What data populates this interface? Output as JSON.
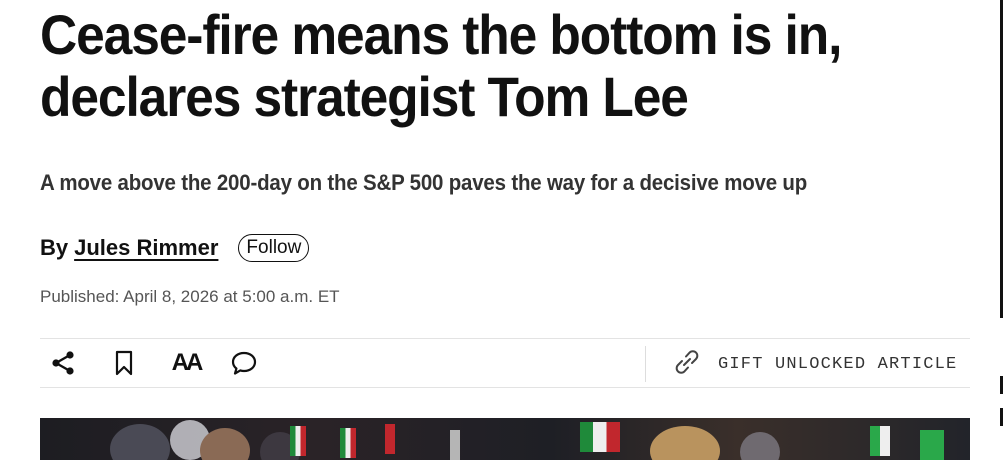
{
  "article": {
    "headline": "Cease-fire means the bottom is in, declares strategist Tom Lee",
    "subheadline": "A move above the 200-day on the S&P 500 paves the way for a decisive move up",
    "byline_prefix": "By",
    "author": "Jules Rimmer",
    "follow_label": "Follow",
    "published": "Published: April 8, 2026 at 5:00 a.m. ET"
  },
  "toolbar": {
    "share_icon": "share-icon",
    "bookmark_icon": "bookmark-icon",
    "text_size_label": "AA",
    "comment_icon": "comment-icon",
    "gift_icon": "link-icon",
    "gift_label": "GIFT UNLOCKED ARTICLE"
  },
  "colors": {
    "text": "#111111",
    "secondary_text": "#555555",
    "border": "#e3e3e3"
  }
}
